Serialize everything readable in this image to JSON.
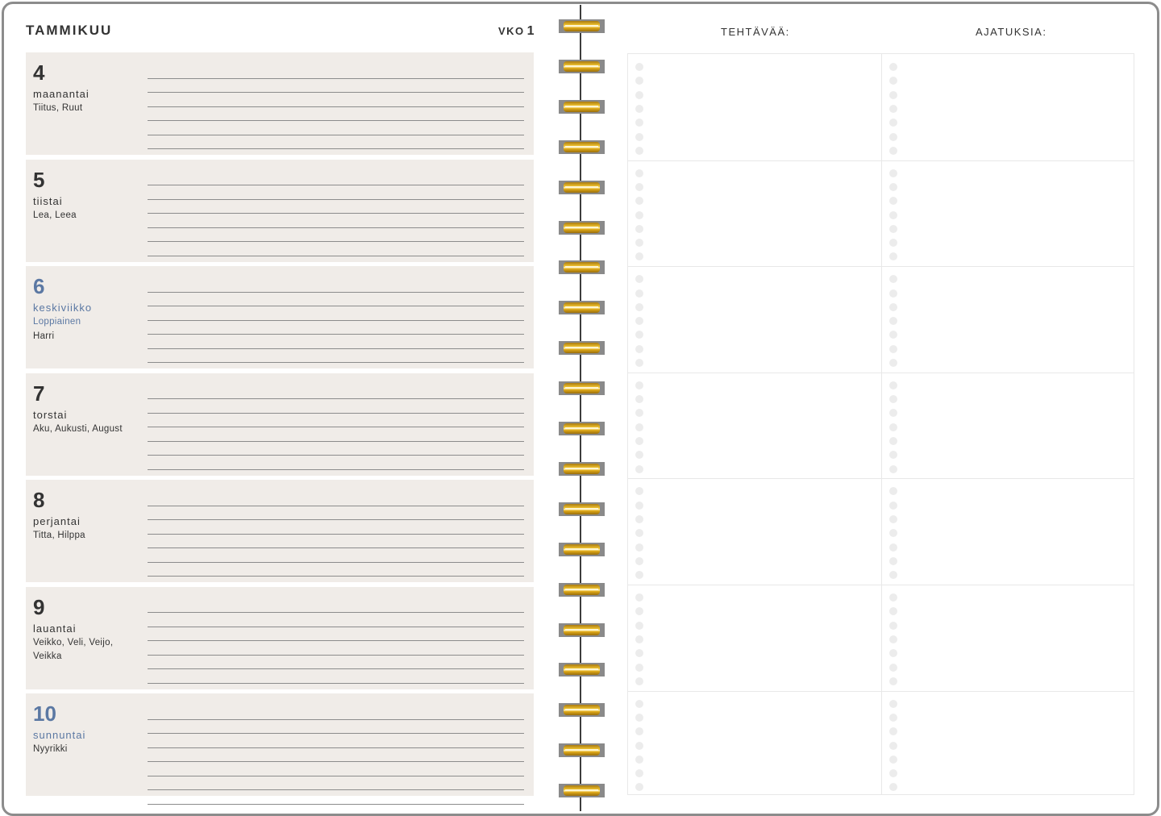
{
  "header": {
    "month": "TAMMIKUU",
    "week_label": "VKO",
    "week_number": "1"
  },
  "days": [
    {
      "number": "4",
      "weekday": "maanantai",
      "holiday": "",
      "names": "Tiitus, Ruut",
      "is_holiday": false
    },
    {
      "number": "5",
      "weekday": "tiistai",
      "holiday": "",
      "names": "Lea, Leea",
      "is_holiday": false
    },
    {
      "number": "6",
      "weekday": "keskiviikko",
      "holiday": "Loppiainen",
      "names": "Harri",
      "is_holiday": true
    },
    {
      "number": "7",
      "weekday": "torstai",
      "holiday": "",
      "names": "Aku, Aukusti, August",
      "is_holiday": false
    },
    {
      "number": "8",
      "weekday": "perjantai",
      "holiday": "",
      "names": "Titta, Hilppa",
      "is_holiday": false
    },
    {
      "number": "9",
      "weekday": "lauantai",
      "holiday": "",
      "names": "Veikko, Veli, Veijo, Veikka",
      "is_holiday": false
    },
    {
      "number": "10",
      "weekday": "sunnuntai",
      "holiday": "",
      "names": "Nyyrikki",
      "is_holiday": true
    }
  ],
  "right": {
    "tasks_title": "TEHTÄVÄÄ:",
    "thoughts_title": "AJATUKSIA:"
  },
  "colors": {
    "text": "#333333",
    "holiday": "#5b78a3",
    "day_bg": "#f0ece8",
    "ring_gold": "#e0aa18",
    "ring_back": "#8a8a8a"
  }
}
